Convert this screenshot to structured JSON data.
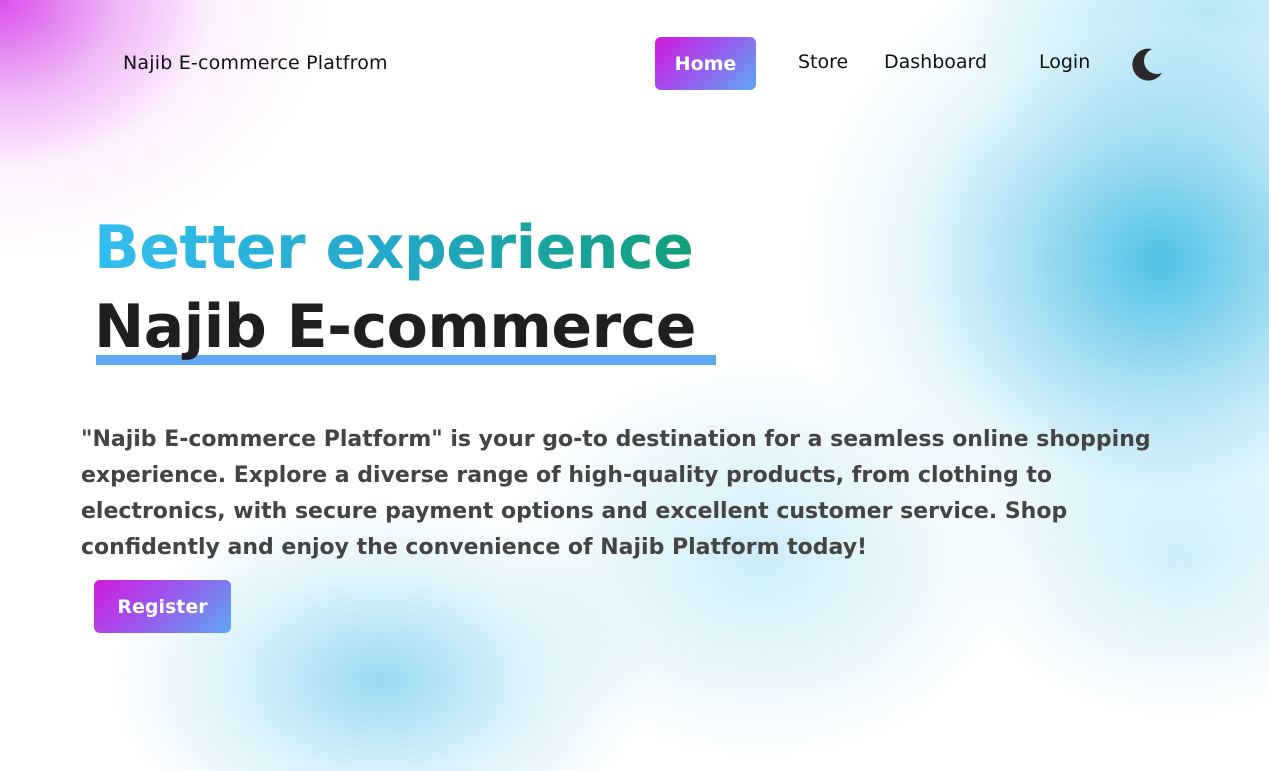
{
  "header": {
    "brand": "Najib E-commerce Platfrom",
    "nav": {
      "home": "Home",
      "store": "Store",
      "dashboard": "Dashboard",
      "login": "Login"
    },
    "theme_icon": "moon-icon"
  },
  "hero": {
    "headline_1": "Better experience",
    "headline_2": "Najib E-commerce",
    "description": "\"Najib E-commerce Platform\" is your go-to destination for a seamless online shopping experience. Explore a diverse range of high-quality products, from clothing to electronics, with secure payment options and excellent customer service. Shop confidently and enjoy the convenience of Najib Platform today!",
    "register_label": "Register"
  },
  "colors": {
    "button_gradient_start": "#d21bdc",
    "button_gradient_end": "#5ca8f2",
    "headline_gradient_start": "#33bff0",
    "headline_gradient_end": "#12a07a",
    "underline": "#5ea8f4",
    "text_dark": "#1f1f1f"
  }
}
